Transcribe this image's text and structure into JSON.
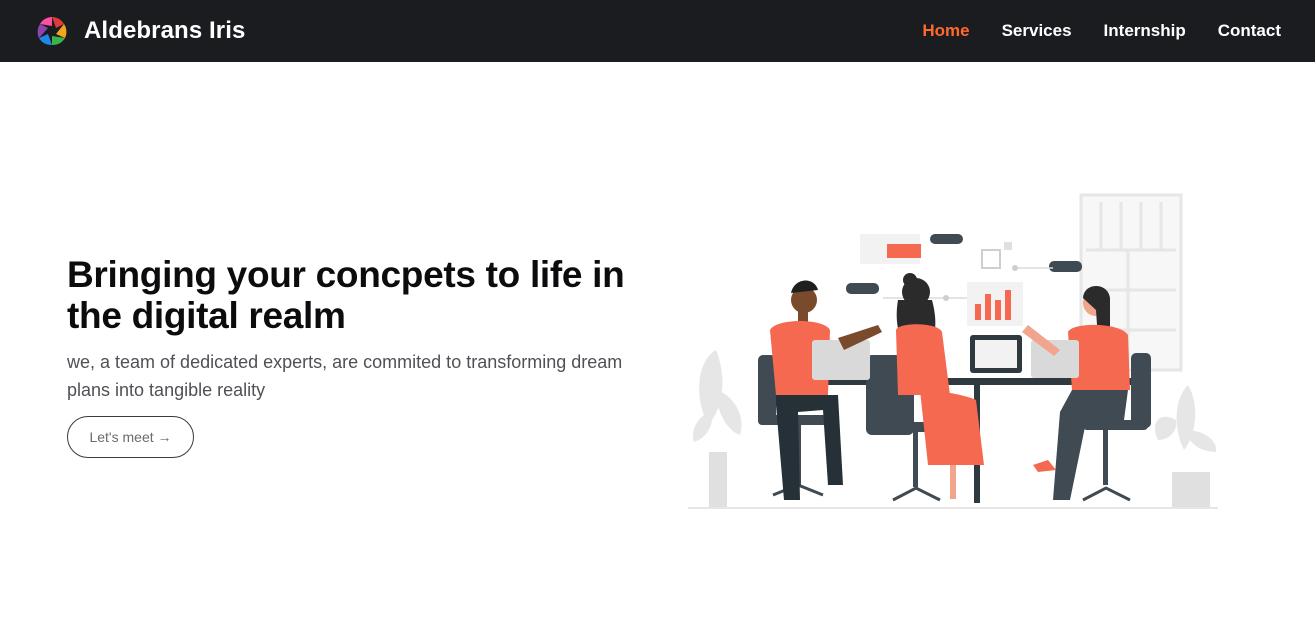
{
  "header": {
    "brand": "Aldebrans Iris",
    "nav": [
      {
        "label": "Home",
        "active": true
      },
      {
        "label": "Services",
        "active": false
      },
      {
        "label": "Internship",
        "active": false
      },
      {
        "label": "Contact",
        "active": false
      }
    ]
  },
  "hero": {
    "title": "Bringing your concpets to life in the digital realm",
    "subtitle": "we, a team of dedicated experts, are commited to transforming dream plans into tangible reality",
    "cta_label": "Let's meet →"
  },
  "colors": {
    "nav_bg": "#1b1c20",
    "accent": "#ff6a2b",
    "illustration_accent": "#f4694f",
    "illustration_dark": "#3f4a52"
  },
  "icons": {
    "logo": "colorful-aperture-logo-icon"
  }
}
